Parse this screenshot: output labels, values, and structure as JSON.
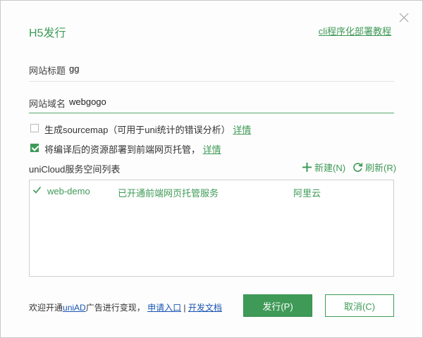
{
  "dialog": {
    "title": "H5发行",
    "cli_link": "cli程序化部署教程",
    "close_icon": "close-icon"
  },
  "fields": {
    "site_title_label": "网站标题",
    "site_title_value": "gg",
    "site_domain_label": "网站域名",
    "site_domain_value": "webgogo"
  },
  "options": {
    "sourcemap": {
      "checked": false,
      "text": "生成sourcemap（可用于uni统计的错误分析）",
      "link": "详情"
    },
    "deploy": {
      "checked": true,
      "text": "将编译后的资源部署到前端网页托管，",
      "link": "详情"
    }
  },
  "unicloud": {
    "title": "uniCloud服务空间列表",
    "new_label": "新建(N)",
    "refresh_label": "刷新(R)",
    "spaces": [
      {
        "name": "web-demo",
        "status": "已开通前端网页托管服务",
        "provider": "阿里云",
        "selected": true
      }
    ]
  },
  "footer": {
    "prefix": "欢迎开通",
    "uniad": "uniAD",
    "middle": "广告进行变现，",
    "apply": "申请入口",
    "separator": "|",
    "docs": "开发文档"
  },
  "buttons": {
    "publish": "发行(P)",
    "cancel": "取消(C)"
  },
  "colors": {
    "accent": "#3f9a57",
    "link_blue": "#1a55b3",
    "border": "#cfcfcf"
  }
}
